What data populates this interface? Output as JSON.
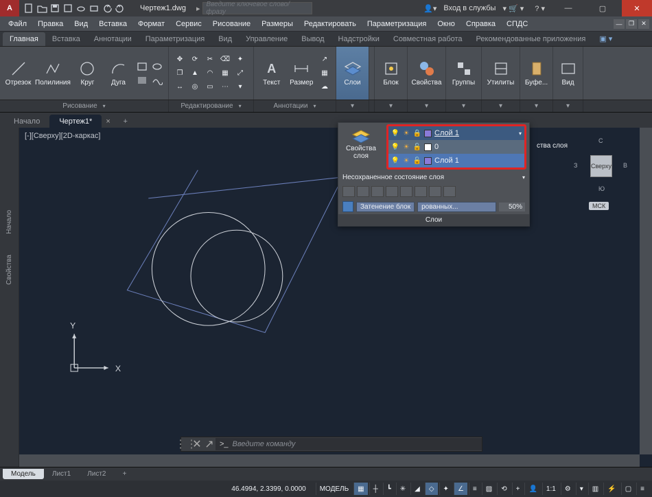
{
  "title": "Чертеж1.dwg",
  "search_placeholder": "Введите ключевое слово/фразу",
  "sign_in": "Вход в службы",
  "menus": [
    "Файл",
    "Правка",
    "Вид",
    "Вставка",
    "Формат",
    "Сервис",
    "Рисование",
    "Размеры",
    "Редактировать",
    "Параметризация",
    "Окно",
    "Справка",
    "СПДС"
  ],
  "ribbon_tabs": [
    "Главная",
    "Вставка",
    "Аннотации",
    "Параметризация",
    "Вид",
    "Управление",
    "Вывод",
    "Надстройки",
    "Совместная работа",
    "Рекомендованные приложения"
  ],
  "ribbon": {
    "draw": {
      "segment": "Отрезок",
      "polyline": "Полилиния",
      "circle": "Круг",
      "arc": "Дуга",
      "label": "Рисование"
    },
    "modify": {
      "label": "Редактирование"
    },
    "annot": {
      "text": "Текст",
      "dim": "Размер",
      "label": "Аннотации"
    },
    "layers": {
      "big": "Слои"
    },
    "block": {
      "big": "Блок"
    },
    "properties": {
      "big": "Свойства"
    },
    "groups": {
      "big": "Группы"
    },
    "utilities": {
      "big": "Утилиты"
    },
    "clipboard": {
      "big": "Буфе..."
    },
    "view": {
      "big": "Вид"
    }
  },
  "file_tabs": {
    "start": "Начало",
    "drawing": "Чертеж1*",
    "close_icon": "×",
    "plus_icon": "+"
  },
  "viewport": {
    "label": "[-][Сверху][2D-каркас]"
  },
  "viewcube": {
    "top": "Сверху",
    "n": "С",
    "s": "Ю",
    "e": "В",
    "w": "З",
    "wcs": "МСК"
  },
  "layers_panel": {
    "props_top": "Свойства",
    "props_bottom": "слоя",
    "ext_right": "ства слоя",
    "combo_current": "Слой 1",
    "list": [
      {
        "name": "0"
      },
      {
        "name": "Слой 1"
      }
    ],
    "state_label": "Несохраненное состояние слоя",
    "shade1": "Затенение блок",
    "shade2": "рованных...",
    "pct": "50%",
    "title": "Слои"
  },
  "side_palettes": {
    "start": "Начало",
    "props": "Свойства"
  },
  "command": {
    "placeholder": "Введите команду",
    "caret": ">_"
  },
  "bottom_tabs": [
    "Модель",
    "Лист1",
    "Лист2"
  ],
  "status": {
    "coords": "46.4994, 2.3399, 0.0000",
    "model": "МОДЕЛЬ",
    "scale": "1:1"
  },
  "ucs": {
    "x": "X",
    "y": "Y"
  }
}
